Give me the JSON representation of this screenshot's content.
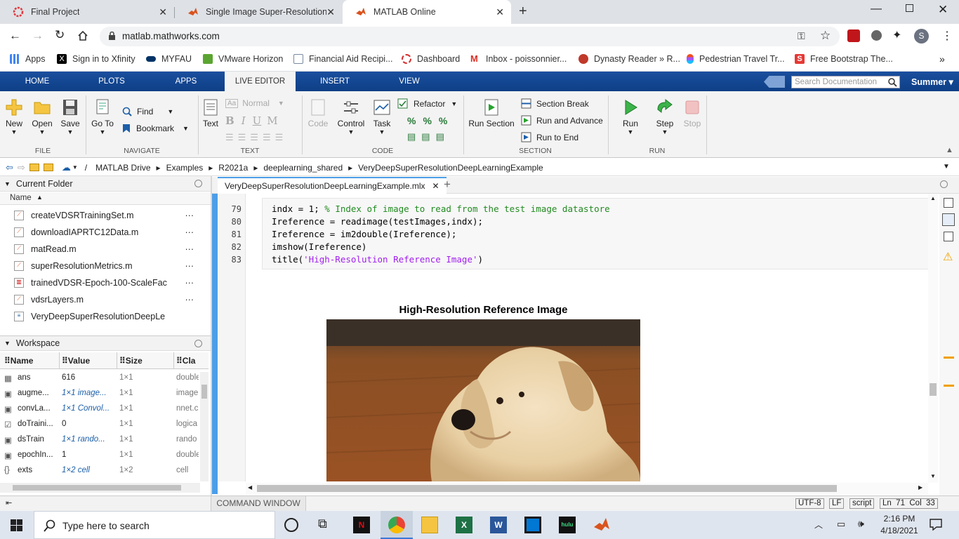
{
  "browser": {
    "tabs": [
      {
        "title": "Final Project",
        "icon": "opera-icon",
        "color": "#e0393e"
      },
      {
        "title": "Single Image Super-Resolution U",
        "icon": "matlab-icon",
        "color": "#d9531e"
      },
      {
        "title": "MATLAB Online",
        "icon": "matlab-icon",
        "color": "#d9531e"
      }
    ],
    "url": "matlab.mathworks.com",
    "profile_initial": "S",
    "bookmarks": [
      {
        "label": "Apps",
        "icon": "apps-grid-icon",
        "color": "#4285f4"
      },
      {
        "label": "Sign in to Xfinity",
        "icon": "xfinity-icon",
        "color": "#000000"
      },
      {
        "label": "MYFAU",
        "icon": "fau-icon",
        "color": "#003366"
      },
      {
        "label": "VMware Horizon",
        "icon": "vmware-icon",
        "color": "#5aa531"
      },
      {
        "label": "Financial Aid Recipi...",
        "icon": "document-icon",
        "color": "#7a8aa0"
      },
      {
        "label": "Dashboard",
        "icon": "circle-icon",
        "color": "#d32f2f"
      },
      {
        "label": "Inbox - poissonnier...",
        "icon": "gmail-icon",
        "color": "#d93025"
      },
      {
        "label": "Dynasty Reader » R...",
        "icon": "dynasty-icon",
        "color": "#c0392b"
      },
      {
        "label": "Pedestrian Travel Tr...",
        "icon": "figma-icon",
        "color": "#f24e1e"
      },
      {
        "label": "Free Bootstrap The...",
        "icon": "s-icon",
        "color": "#e53935"
      }
    ]
  },
  "matlab": {
    "nav_tabs": [
      "HOME",
      "PLOTS",
      "APPS",
      "LIVE EDITOR",
      "INSERT",
      "VIEW"
    ],
    "active_tab": "LIVE EDITOR",
    "search_placeholder": "Search Documentation",
    "user": "Summer",
    "ribbon": {
      "file": {
        "new": "New",
        "open": "Open",
        "save": "Save",
        "section": "FILE"
      },
      "navigate": {
        "goto": "Go To",
        "find": "Find",
        "bookmark": "Bookmark",
        "section": "NAVIGATE"
      },
      "text": {
        "text": "Text",
        "style": "Normal",
        "section": "TEXT"
      },
      "code": {
        "code": "Code",
        "control": "Control",
        "task": "Task",
        "refactor": "Refactor",
        "section": "CODE"
      },
      "section": {
        "run_section": "Run Section",
        "section_break": "Section Break",
        "run_advance": "Run and Advance",
        "run_to_end": "Run to End",
        "section": "SECTION"
      },
      "run": {
        "run": "Run",
        "step": "Step",
        "stop": "Stop",
        "section": "RUN"
      }
    },
    "path": [
      "/",
      "MATLAB Drive",
      "Examples",
      "R2021a",
      "deeplearning_shared",
      "VeryDeepSuperResolutionDeepLearningExample"
    ],
    "current_folder": {
      "title": "Current Folder",
      "column": "Name",
      "files": [
        "createVDSRTrainingSet.m",
        "downloadIAPRTC12Data.m",
        "matRead.m",
        "superResolutionMetrics.m",
        "trainedVDSR-Epoch-100-ScaleFac",
        "vdsrLayers.m",
        "VeryDeepSuperResolutionDeepLe"
      ]
    },
    "workspace": {
      "title": "Workspace",
      "columns": [
        "Name",
        "Value",
        "Size",
        "Cla"
      ],
      "rows": [
        {
          "name": "ans",
          "value": "616",
          "size": "1×1",
          "class": "double",
          "italic": false
        },
        {
          "name": "augme...",
          "value": "1×1 image...",
          "size": "1×1",
          "class": "image",
          "italic": true
        },
        {
          "name": "convLa...",
          "value": "1×1 Convol...",
          "size": "1×1",
          "class": "nnet.c",
          "italic": true
        },
        {
          "name": "doTraini...",
          "value": "0",
          "size": "1×1",
          "class": "logica",
          "italic": false
        },
        {
          "name": "dsTrain",
          "value": "1×1 rando...",
          "size": "1×1",
          "class": "rando",
          "italic": true
        },
        {
          "name": "epochIn...",
          "value": "1",
          "size": "1×1",
          "class": "double",
          "italic": false
        },
        {
          "name": "exts",
          "value": "1×2 cell",
          "size": "1×2",
          "class": "cell",
          "italic": true
        }
      ]
    },
    "editor": {
      "tab": "VeryDeepSuperResolutionDeepLearningExample.mlx",
      "lines": [
        {
          "num": "79",
          "code": "indx = 1; ",
          "comment": "% Index of image to read from the test image datastore"
        },
        {
          "num": "80",
          "code": "Ireference = readimage(testImages,indx);"
        },
        {
          "num": "81",
          "code": "Ireference = im2double(Ireference);"
        },
        {
          "num": "82",
          "code": "imshow(Ireference)"
        },
        {
          "num": "83",
          "code": "title(",
          "string": "'High-Resolution Reference Image'",
          "tail": ")"
        }
      ],
      "figure_title": "High-Resolution Reference Image"
    },
    "status": {
      "command_window": "COMMAND WINDOW",
      "encoding": "UTF-8",
      "eol": "LF",
      "mode": "script",
      "position": "Ln  71  Col  33"
    }
  },
  "taskbar": {
    "search_placeholder": "Type here to search",
    "time": "2:16 PM",
    "date": "4/18/2021"
  }
}
